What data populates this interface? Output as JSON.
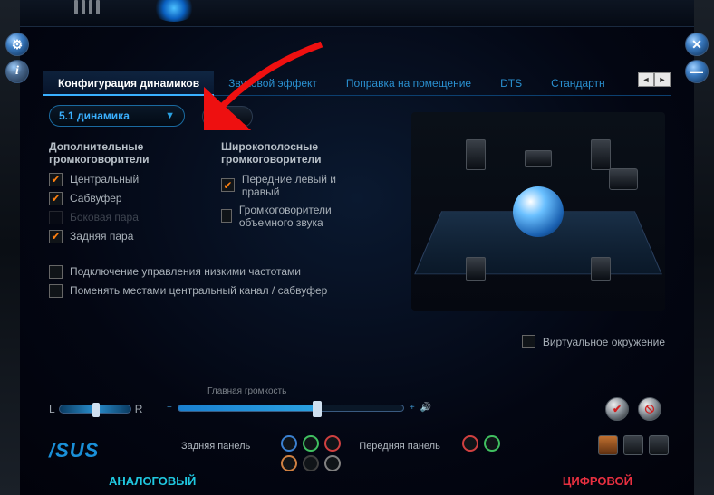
{
  "tabs": {
    "speaker_config": "Конфигурация динамиков",
    "sound_effect": "Звуковой эффект",
    "room_correction": "Поправка на помещение",
    "dts": "DTS",
    "default": "Стандартн"
  },
  "dropdown": {
    "selected": "5.1 динамика"
  },
  "additional": {
    "heading": "Дополнительные громкоговорители",
    "center": "Центральный",
    "sub": "Сабвуфер",
    "side": "Боковая пара",
    "rear": "Задняя пара"
  },
  "fullrange": {
    "heading": "Широкополосные громкоговорители",
    "front": "Передние левый и правый",
    "surround": "Громкоговорители объемного звука"
  },
  "bass_mgmt": "Подключение управления низкими частотами",
  "swap_center_sub": "Поменять местами центральный канал / сабвуфер",
  "virtual_env": "Виртуальное окружение",
  "volume": {
    "title": "Главная громкость",
    "left": "L",
    "right": "R",
    "minus": "−",
    "plus": "+"
  },
  "bottom": {
    "brand": "/SUS",
    "rear_panel": "Задняя панель",
    "front_panel": "Передняя панель",
    "analog": "АНАЛОГОВЫЙ",
    "digital": "ЦИФРОВОЙ"
  },
  "edge_buttons": {
    "settings": "⚙",
    "info": "i",
    "close": "✕",
    "min": "—"
  }
}
